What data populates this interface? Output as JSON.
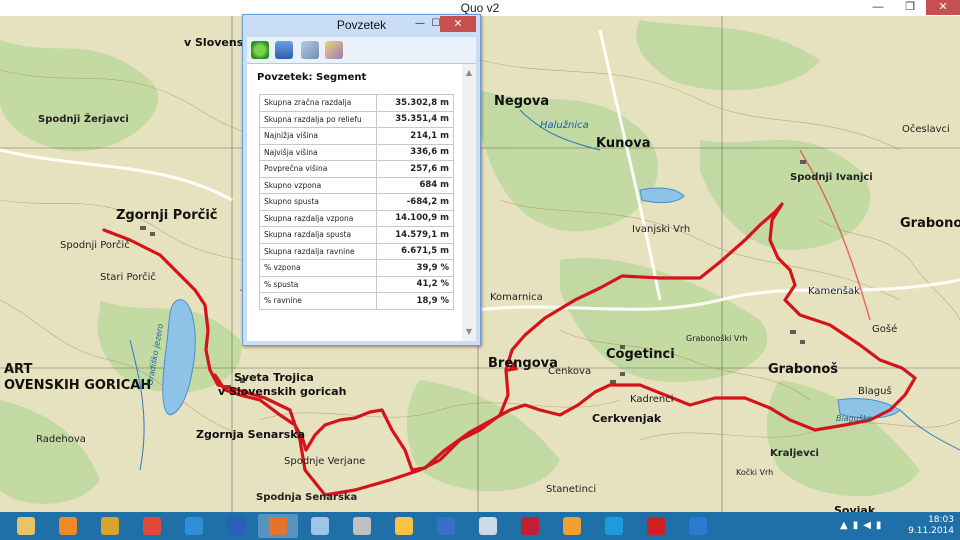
{
  "window": {
    "title": "Quo v2",
    "minimize": "—",
    "restore": "❐",
    "close": "✕"
  },
  "dialog": {
    "title": "Povzetek",
    "minimize": "—",
    "maximize": "☐",
    "close": "✕",
    "heading": "Povzetek: Segment",
    "toolbar": [
      "refresh-icon",
      "save-icon",
      "export-icon",
      "settings-icon"
    ],
    "rows": [
      {
        "label": "Skupna zračna razdalja",
        "value": "35.302,8 m"
      },
      {
        "label": "Skupna razdalja po reliefu",
        "value": "35.351,4 m"
      },
      {
        "label": "Najnižja višina",
        "value": "214,1 m"
      },
      {
        "label": "Najvišja višina",
        "value": "336,6 m"
      },
      {
        "label": "Povprečna višina",
        "value": "257,6 m"
      },
      {
        "label": "Skupno vzpona",
        "value": "684 m"
      },
      {
        "label": "Skupno spusta",
        "value": "-684,2 m"
      },
      {
        "label": "Skupna razdalja vzpona",
        "value": "14.100,9 m"
      },
      {
        "label": "Skupna razdalja spusta",
        "value": "14.579,1 m"
      },
      {
        "label": "Skupna razdalja ravnine",
        "value": "6.671,5 m"
      },
      {
        "label": "% vzpona",
        "value": "39,9 %"
      },
      {
        "label": "% spusta",
        "value": "41,2 %"
      },
      {
        "label": "% ravnine",
        "value": "18,9 %"
      }
    ]
  },
  "map": {
    "labels": {
      "zgornji_porcic": "Zgornji Porčič",
      "spodnji_porcic": "Spodnji Porčič",
      "stari_porcic": "Stari Porčič",
      "slovenskih_goricah": "OVENSKIH GORICAH",
      "art": "ART",
      "sveta_trojica": "Sveta Trojica",
      "v_slov_goricah": "v Slovenskih goricah",
      "zgornja_senarska": "Zgornja Senarska",
      "spodnja_senarska": "Spodnja Senarska",
      "spodnje_verjane": "Spodnje Verjane",
      "radehova": "Radehova",
      "negova": "Negova",
      "kunova": "Kunova",
      "brengova": "Brengova",
      "cogetinci": "Cogetinci",
      "cenkova": "Cenkova",
      "komarnica": "Komarnica",
      "ivanjski_vrh": "Ivanjski Vrh",
      "kadrenci": "Kadrenci",
      "cerkvenjak": "Cerkvenjak",
      "grabonos": "Grabonoš",
      "grabonos2": "Grabonoš",
      "spodnji_ivanjci": "Spodnji Ivanjci",
      "kamensak": "Kamenšak",
      "blagus": "Blaguš",
      "kraljevci": "Kraljevci",
      "sovjak": "Sovjak",
      "ocieslavci": "Očeslavci",
      "stanetinci": "Stanetinci",
      "v_slovensk": "v Slovensk",
      "spodnji_zerjavci": "Spodnji Žerjavci",
      "halunica": "Halužnica",
      "gradisko": "Gradiško jezero",
      "blagusko": "Blaguško",
      "gose": "Gošé",
      "grabonosk_vrh": "Grabonoški Vrh",
      "kocki_vrh": "Kočki Vrh"
    }
  },
  "taskbar": {
    "apps": [
      "file-explorer-icon",
      "outlook-icon",
      "winamp-icon",
      "chrome-icon",
      "internet-explorer-icon",
      "word-icon",
      "quo-icon",
      "tablet-icon",
      "calculator-icon",
      "drive-icon",
      "network-icon",
      "image-icon",
      "bug-icon",
      "paint-icon",
      "skype-icon",
      "acrobat-icon",
      "google-earth-icon"
    ],
    "time": "18:03",
    "date": "9.11.2014"
  },
  "colors": {
    "route": "#d4141a",
    "taskbar": "#1f6fa8",
    "dialog_frame": "#c9def4"
  }
}
